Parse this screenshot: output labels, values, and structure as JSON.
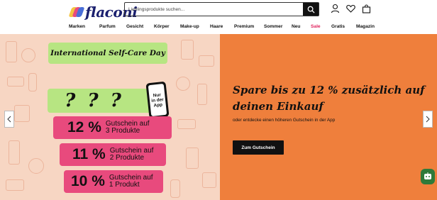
{
  "header": {
    "logo_text": "flaconi",
    "search": {
      "placeholder": "Lieblingsprodukte suchen..."
    },
    "icons": [
      "search-icon",
      "user-icon",
      "heart-icon",
      "bag-icon"
    ]
  },
  "nav": {
    "items": [
      {
        "label": "Marken",
        "color": "#111111"
      },
      {
        "label": "Parfum",
        "color": "#111111"
      },
      {
        "label": "Gesicht",
        "color": "#111111"
      },
      {
        "label": "Körper",
        "color": "#111111"
      },
      {
        "label": "Make-up",
        "color": "#111111"
      },
      {
        "label": "Haare",
        "color": "#111111"
      },
      {
        "label": "Premium",
        "color": "#111111"
      },
      {
        "label": "Sommer",
        "color": "#111111"
      },
      {
        "label": "Neu",
        "color": "#111111"
      },
      {
        "label": "Sale",
        "color": "#e0245e"
      },
      {
        "label": "Gratis",
        "color": "#111111"
      },
      {
        "label": "Magazin",
        "color": "#111111"
      }
    ]
  },
  "banner": {
    "left": {
      "title": "International Self-Care Day",
      "question": "? ? ?",
      "phone_text": "Nur\nin der\nApp",
      "offers": [
        {
          "pct": "12 %",
          "desc": "Gutschein auf\n3 Produkte"
        },
        {
          "pct": "11 %",
          "desc": "Gutschein auf\n2 Produkte"
        },
        {
          "pct": "10 %",
          "desc": "Gutschein auf\n1 Produkt"
        }
      ]
    },
    "right": {
      "headline": "Spare bis zu 12 % zusätzlich auf deinen Einkauf",
      "subline": "oder entdecke einen höheren Gutschein in der App",
      "cta": "Zum Gutschein"
    }
  },
  "colors": {
    "left_bg": "#f7d6c3",
    "right_bg": "#ef7f3c",
    "accent_green": "#b7e582",
    "accent_pink": "#e84a7d",
    "sale_red": "#e0245e"
  }
}
